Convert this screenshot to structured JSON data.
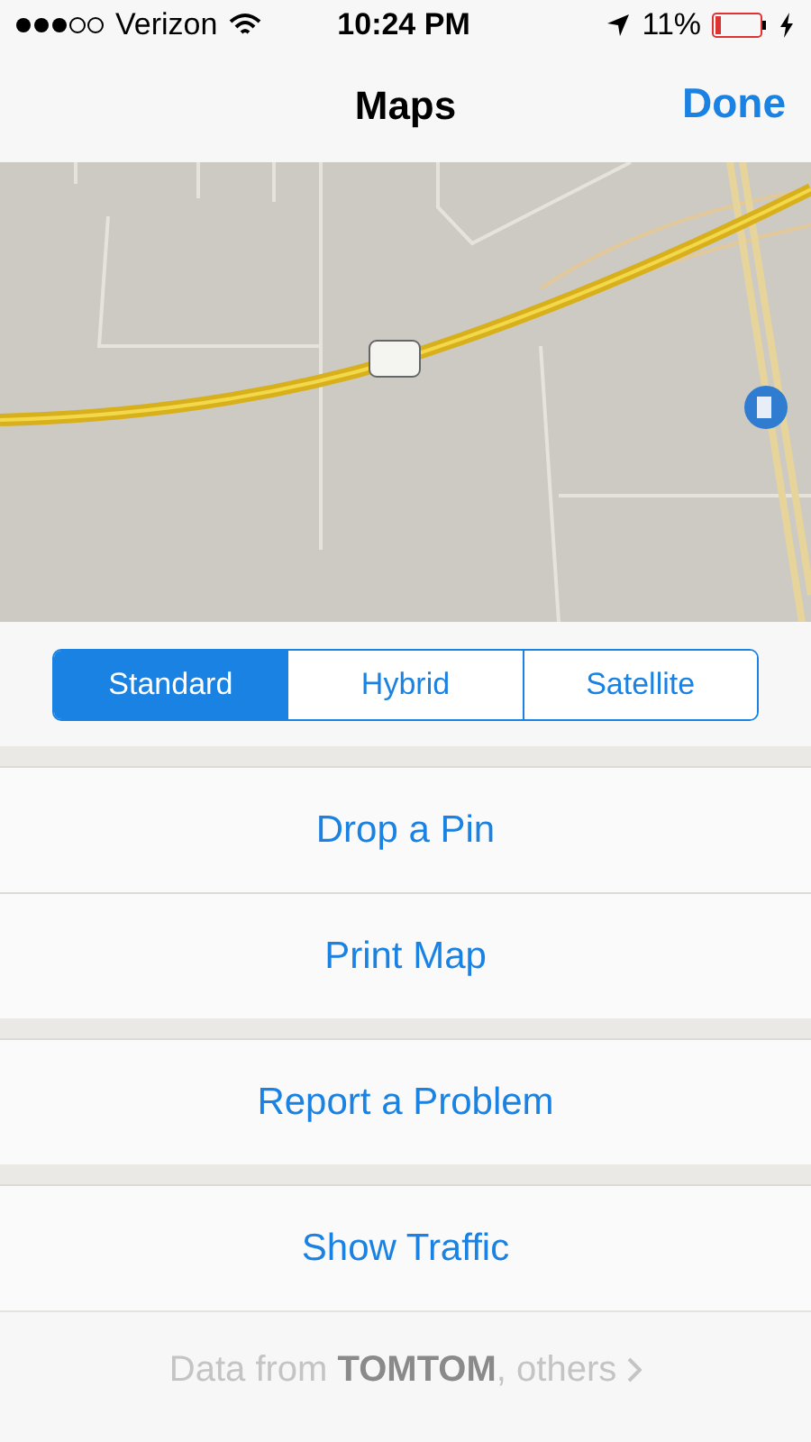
{
  "status_bar": {
    "carrier": "Verizon",
    "time": "10:24 PM",
    "battery": "11%"
  },
  "nav_bar": {
    "title": "Maps",
    "done": "Done"
  },
  "map_type": [
    {
      "label": "Standard",
      "selected": true
    },
    {
      "label": "Hybrid",
      "selected": false
    },
    {
      "label": "Satellite",
      "selected": false
    }
  ],
  "menu_groups": [
    {
      "items": [
        "Drop a Pin",
        "Print Map"
      ]
    },
    {
      "items": [
        "Report a Problem"
      ]
    },
    {
      "items": [
        "Show Traffic"
      ]
    }
  ],
  "footer": {
    "text": "Data from **TOMTOM**, others"
  }
}
